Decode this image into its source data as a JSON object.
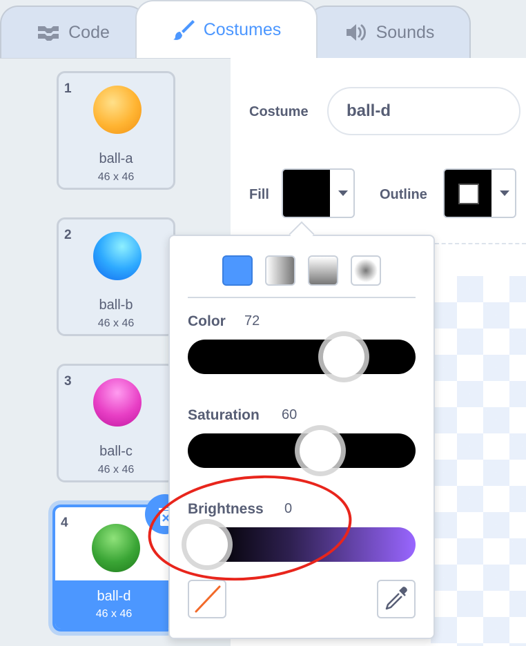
{
  "tabs": [
    {
      "label": "Code",
      "icon": "code-blocks-icon"
    },
    {
      "label": "Costumes",
      "icon": "paintbrush-icon",
      "active": true
    },
    {
      "label": "Sounds",
      "icon": "speaker-icon"
    }
  ],
  "costumes": [
    {
      "number": "1",
      "name": "ball-a",
      "size": "46 x 46",
      "color": "#ffb432"
    },
    {
      "number": "2",
      "name": "ball-b",
      "size": "46 x 46",
      "color": "#2eaaff"
    },
    {
      "number": "3",
      "name": "ball-c",
      "size": "46 x 46",
      "color": "#e83fc5"
    },
    {
      "number": "4",
      "name": "ball-d",
      "size": "46 x 46",
      "color": "#3aa535",
      "selected": true
    }
  ],
  "editor": {
    "costume_label": "Costume",
    "costume_name": "ball-d",
    "fill_label": "Fill",
    "outline_label": "Outline",
    "fill_color": "#000000",
    "outline_color": "#000000"
  },
  "color_picker": {
    "fill_modes": [
      "solid",
      "horizontal-gradient",
      "vertical-gradient",
      "radial-gradient"
    ],
    "selected_mode": "solid",
    "sliders": [
      {
        "label": "Color",
        "value": "72"
      },
      {
        "label": "Saturation",
        "value": "60"
      },
      {
        "label": "Brightness",
        "value": "0"
      }
    ],
    "buttons": [
      "no-color",
      "eyedropper"
    ]
  },
  "colors": {
    "accent": "#4c97ff",
    "highlight_annotation": "#e8251c"
  }
}
